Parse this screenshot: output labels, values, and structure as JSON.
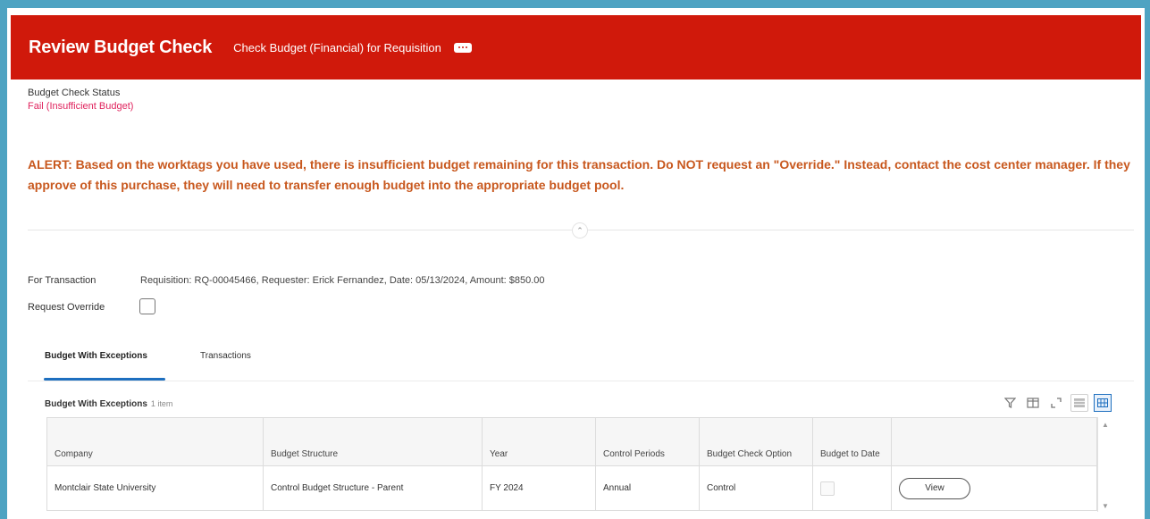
{
  "header": {
    "title": "Review Budget Check",
    "subtitle": "Check Budget (Financial) for Requisition",
    "more_icon": "more-horizontal-icon"
  },
  "status": {
    "label": "Budget Check Status",
    "value": "Fail (Insufficient Budget)"
  },
  "alert": {
    "text": "ALERT: Based on the worktags you have used, there is insufficient budget remaining for this transaction.  Do NOT request an \"Override.\"  Instead, contact the cost center manager.  If they approve of this purchase, they will need to transfer enough budget into the appropriate budget pool."
  },
  "fields": {
    "transaction_label": "For Transaction",
    "transaction_value": "Requisition: RQ-00045466, Requester: Erick Fernandez, Date: 05/13/2024, Amount: $850.00",
    "override_label": "Request Override",
    "override_checked": false
  },
  "tabs": [
    {
      "label": "Budget With Exceptions",
      "active": true
    },
    {
      "label": "Transactions",
      "active": false
    }
  ],
  "grid": {
    "title": "Budget With Exceptions",
    "count": "1 item",
    "toolbar": [
      "filter-icon",
      "columns-icon",
      "fullscreen-icon",
      "list-view-icon",
      "grid-view-icon"
    ],
    "columns": [
      "Company",
      "Budget Structure",
      "Year",
      "Control Periods",
      "Budget Check Option",
      "Budget to Date",
      ""
    ],
    "rows": [
      {
        "company": "Montclair State University",
        "budget_structure": "Control Budget Structure - Parent",
        "year": "FY 2024",
        "control_periods": "Annual",
        "budget_check_option": "Control",
        "budget_to_date": "",
        "action_label": "View"
      }
    ]
  },
  "colors": {
    "header_bg": "#d0190b",
    "alert_text": "#c8581e",
    "fail_text": "#e0245e",
    "accent": "#1e6fbf"
  }
}
